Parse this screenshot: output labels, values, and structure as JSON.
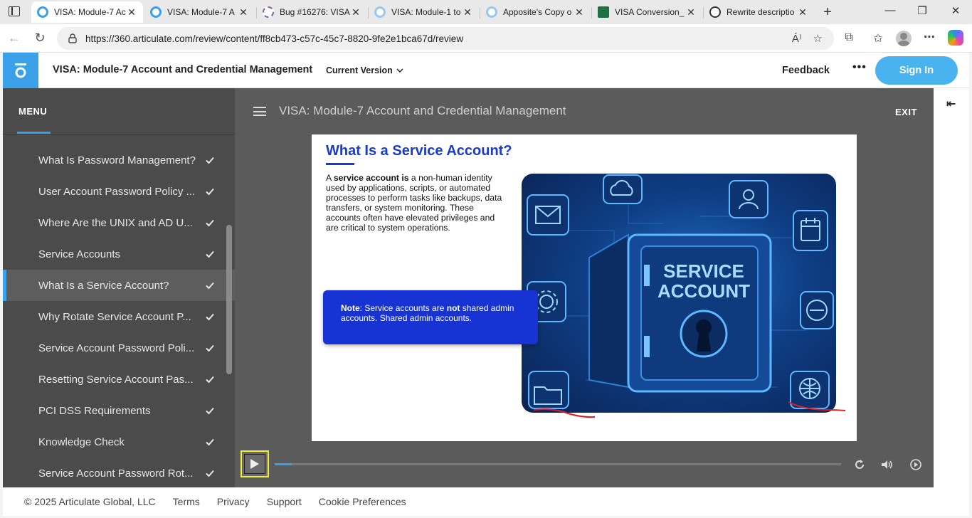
{
  "browser": {
    "tabs": [
      {
        "title": "VISA: Module-7 Ac",
        "active": true
      },
      {
        "title": "VISA: Module-7 A",
        "active": false
      },
      {
        "title": "Bug #16276: VISA",
        "active": false
      },
      {
        "title": "VISA: Module-1 to",
        "active": false
      },
      {
        "title": "Apposite's Copy o",
        "active": false
      },
      {
        "title": "VISA Conversion_",
        "active": false
      },
      {
        "title": "Rewrite descriptio",
        "active": false
      }
    ],
    "url": "https://360.articulate.com/review/content/ff8cb473-c57c-45c7-8820-9fe2e1bca67d/review",
    "read_aloud_label": "Á⁾"
  },
  "header": {
    "title": "VISA: Module-7 Account and Credential Management",
    "version": "Current Version",
    "feedback": "Feedback",
    "more": "•••",
    "sign_in": "Sign In"
  },
  "player": {
    "menu_label": "MENU",
    "course_title": "VISA: Module-7 Account and Credential Management",
    "exit_label": "EXIT",
    "menu_items": [
      {
        "label": "What Is Password Management?",
        "active": false
      },
      {
        "label": "User Account Password Policy ...",
        "active": false
      },
      {
        "label": "Where Are the UNIX and AD U...",
        "active": false
      },
      {
        "label": "Service Accounts",
        "active": false
      },
      {
        "label": "What Is a Service Account?",
        "active": true
      },
      {
        "label": "Why Rotate Service Account P...",
        "active": false
      },
      {
        "label": "Service Account Password Poli...",
        "active": false
      },
      {
        "label": "Resetting Service Account Pas...",
        "active": false
      },
      {
        "label": "PCI DSS Requirements",
        "active": false
      },
      {
        "label": "Knowledge Check",
        "active": false
      },
      {
        "label": "Service Account Password Rot...",
        "active": false
      }
    ],
    "progress_fraction": 0.03
  },
  "slide": {
    "title": "What Is a Service Account?",
    "body_lead": "A ",
    "body_bold": "service account is",
    "body_rest": " a non-human identity used by applications, scripts, or automated processes to perform tasks like backups, data transfers, or system monitoring. These accounts often have elevated privileges and are critical to system operations.",
    "note_bold": "Note",
    "note_mid": ": Service accounts are ",
    "note_bold2": "not",
    "note_rest": " shared admin accounts. Shared admin accounts.",
    "vault_line1": "SERVICE",
    "vault_line2": "ACCOUNT"
  },
  "footer": {
    "copyright": "© 2025 Articulate Global, LLC",
    "links": [
      "Terms",
      "Privacy",
      "Support",
      "Cookie Preferences"
    ]
  },
  "colors": {
    "accent": "#3aa0e8",
    "slide_blue": "#1a3ac8",
    "note_blue": "#1733d4",
    "annotation_red": "#e01b24",
    "focus_yellow": "#f3ef35"
  }
}
